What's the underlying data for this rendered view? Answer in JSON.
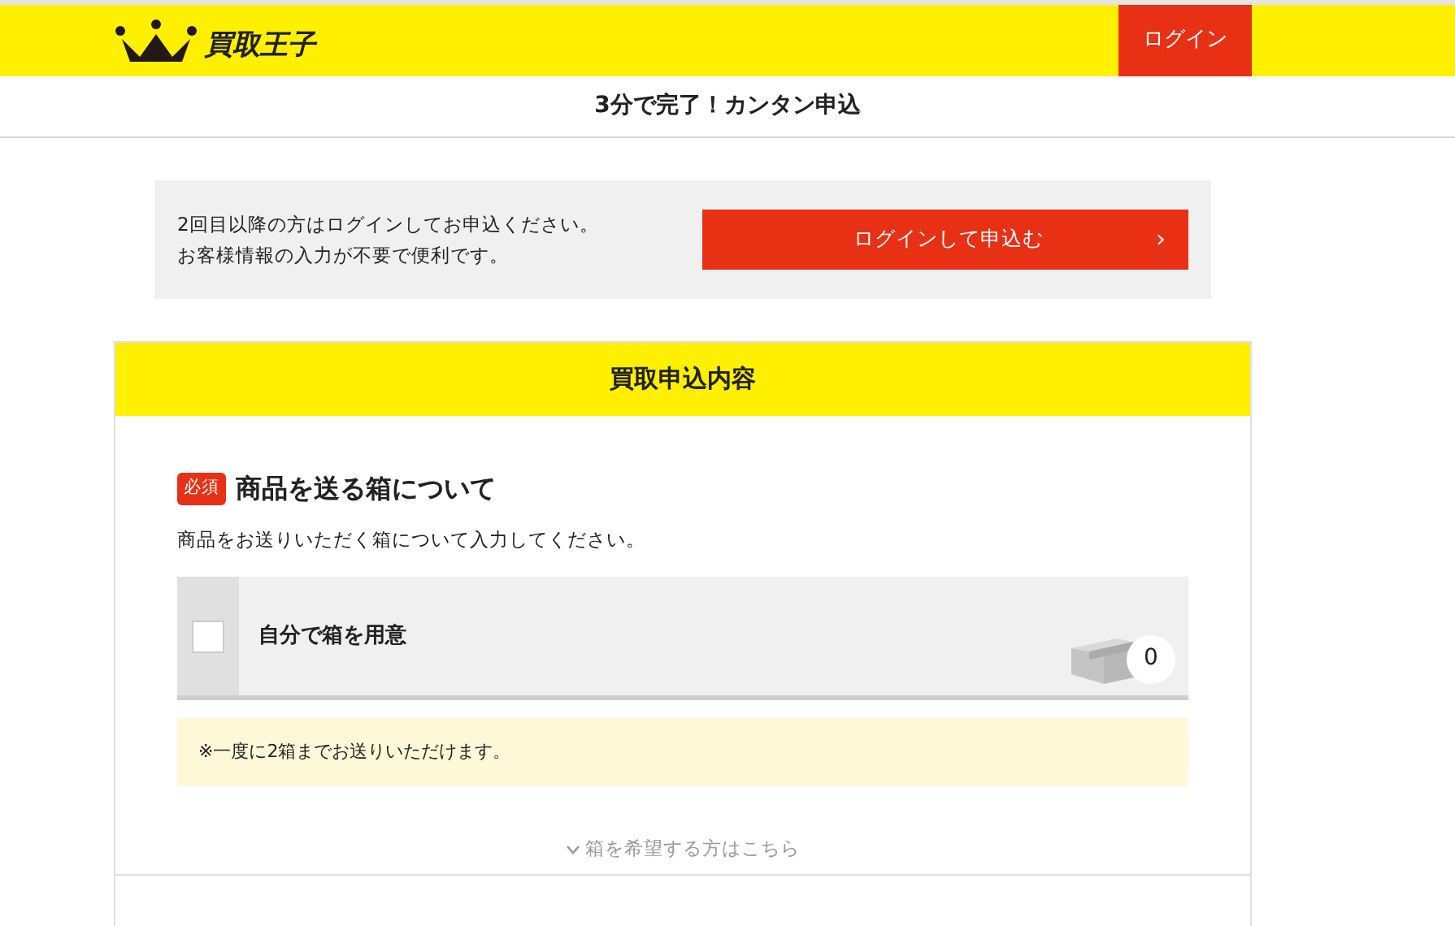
{
  "header": {
    "logo": "買取王子",
    "login_button": "ログイン"
  },
  "page_title": "3分で完了！カンタン申込",
  "login_notice": {
    "lines": [
      "2回目以降の方はログインしてお申込ください。",
      "お客様情報の入力が不要で便利です。"
    ],
    "button": "ログインして申込む",
    "button_arrow": "›"
  },
  "form": {
    "title": "買取申込内容",
    "section": {
      "badge": "必須",
      "heading": "商品を送る箱について",
      "description": "商品をお送りいただく箱について入力してください。",
      "option": {
        "label": "自分で箱を用意",
        "checked": false,
        "count": "0"
      },
      "note": "※一度に2箱までお送りいただけます。",
      "toggle": "箱を希望する方はこちら"
    }
  }
}
